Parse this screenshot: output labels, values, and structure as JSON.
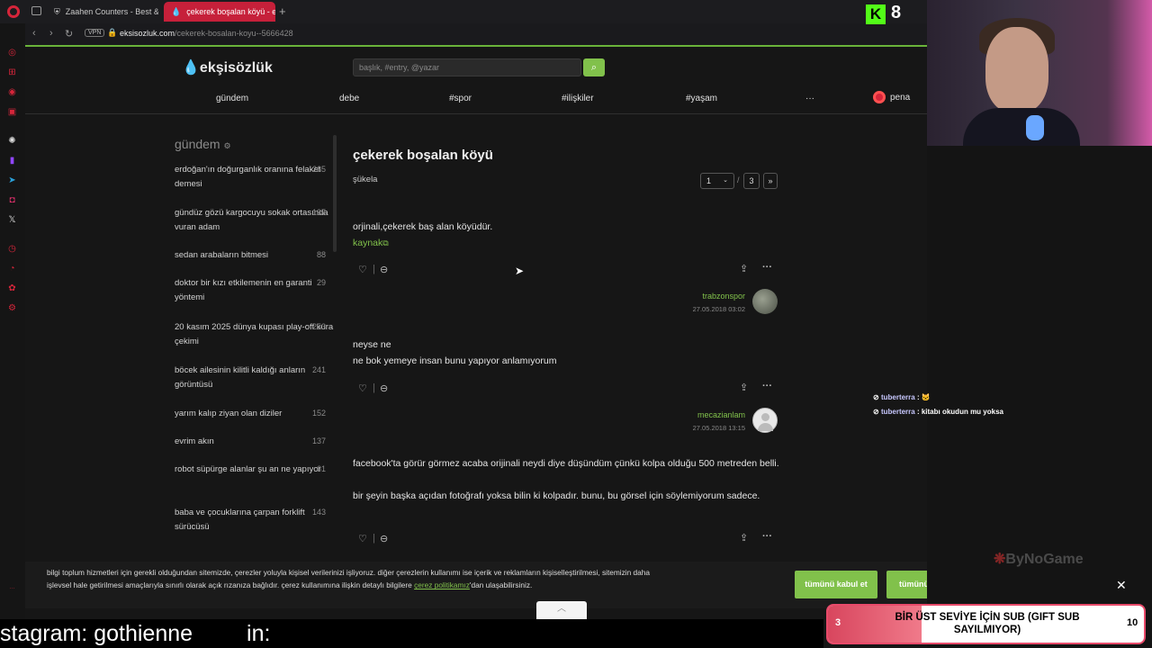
{
  "browser": {
    "tabs": [
      {
        "title": "Zaahen Counters - Best &",
        "active": false
      },
      {
        "title": "çekerek boşalan köyü - e",
        "active": true
      }
    ],
    "url_host": "eksisozluk.com",
    "url_path": "/cekerek-bosalan-koyu--5666428",
    "vpn_label": "VPN"
  },
  "site": {
    "logo": "ekşisözlük",
    "search_placeholder": "başlık, #entry, @yazar",
    "nav": [
      "gündem",
      "debe",
      "#spor",
      "#ilişkiler",
      "#yaşam",
      "···"
    ],
    "user": "pena"
  },
  "gundem": {
    "title": "gündem",
    "items": [
      {
        "title": "erdoğan'ın doğurganlık oranına felaket demesi",
        "count": "265"
      },
      {
        "title": "gündüz gözü kargocuyu sokak ortasında vuran adam",
        "count": "137"
      },
      {
        "title": "sedan arabaların bitmesi",
        "count": "88"
      },
      {
        "title": "doktor bir kızı etkilemenin en garanti yöntemi",
        "count": "29"
      },
      {
        "title": "20 kasım 2025 dünya kupası play-off kura çekimi",
        "count": "253"
      },
      {
        "title": "böcek ailesinin kilitli kaldığı anların görüntüsü",
        "count": "241"
      },
      {
        "title": "yarım kalıp ziyan olan diziler",
        "count": "152"
      },
      {
        "title": "evrim akın",
        "count": "137"
      },
      {
        "title": "robot süpürge alanlar şu an ne yapıyor",
        "count": "61"
      },
      {
        "title": "baba ve çocuklarına çarpan forklift sürücüsü",
        "count": "143"
      }
    ]
  },
  "topic": {
    "title": "çekerek boşalan köyü",
    "filter": "şükela",
    "page_current": "1",
    "page_sep": "/",
    "page_total": "3",
    "page_next": "»"
  },
  "entries": [
    {
      "lines": [
        "orjinali,çekerek baş alan köyüdür."
      ],
      "source": "kaynak",
      "author": "trabzonspor",
      "date": "27.05.2018 03:02"
    },
    {
      "lines": [
        "neyse ne",
        "ne bok yemeye insan bunu yapıyor anlamıyorum"
      ],
      "author": "mecazianlam",
      "date": "27.05.2018 13:15"
    },
    {
      "lines": [
        "facebook'ta görür görmez acaba orijinali neydi diye düşündüm çünkü kolpa olduğu 500 metreden belli.",
        "bir şeyin başka açıdan fotoğrafı yoksa bilin ki kolpadır. bunu, bu görsel için söylemiyorum sadece."
      ]
    }
  ],
  "cookie": {
    "text_before": "bilgi toplum hizmetleri için gerekli olduğundan sitemizde, çerezler yoluyla kişisel verilerinizi işliyoruz. diğer çerezlerin kullanımı ise içerik ve reklamların kişiselleştirilmesi, sitemizin daha işlevsel hale getirilmesi amaçlarıyla sınırlı olarak açık rızanıza bağlıdır. çerez kullanımına ilişkin detaylı bilgilere ",
    "link": "çerez politikamız",
    "text_after": "'dan ulaşabilirsiniz.",
    "accept": "tümünü kabul et",
    "reject": "tümünü reddet"
  },
  "overlay": {
    "kick_count": "8",
    "kick_letter": "K",
    "chat": [
      {
        "name": "tuberterra",
        "msg": ""
      },
      {
        "name": "tuberterra",
        "msg": "kitabı okudun mu yoksa"
      }
    ],
    "chat_sep": " : ",
    "watermark": "ByNoGame",
    "subgoal_left": "3",
    "subgoal_text": "BİR ÜST SEVİYE İÇİN SUB (GIFT SUB SAYILMIYOR)",
    "subgoal_right": "10",
    "ticker_1": "stagram: gothienne",
    "ticker_2": "in:"
  }
}
